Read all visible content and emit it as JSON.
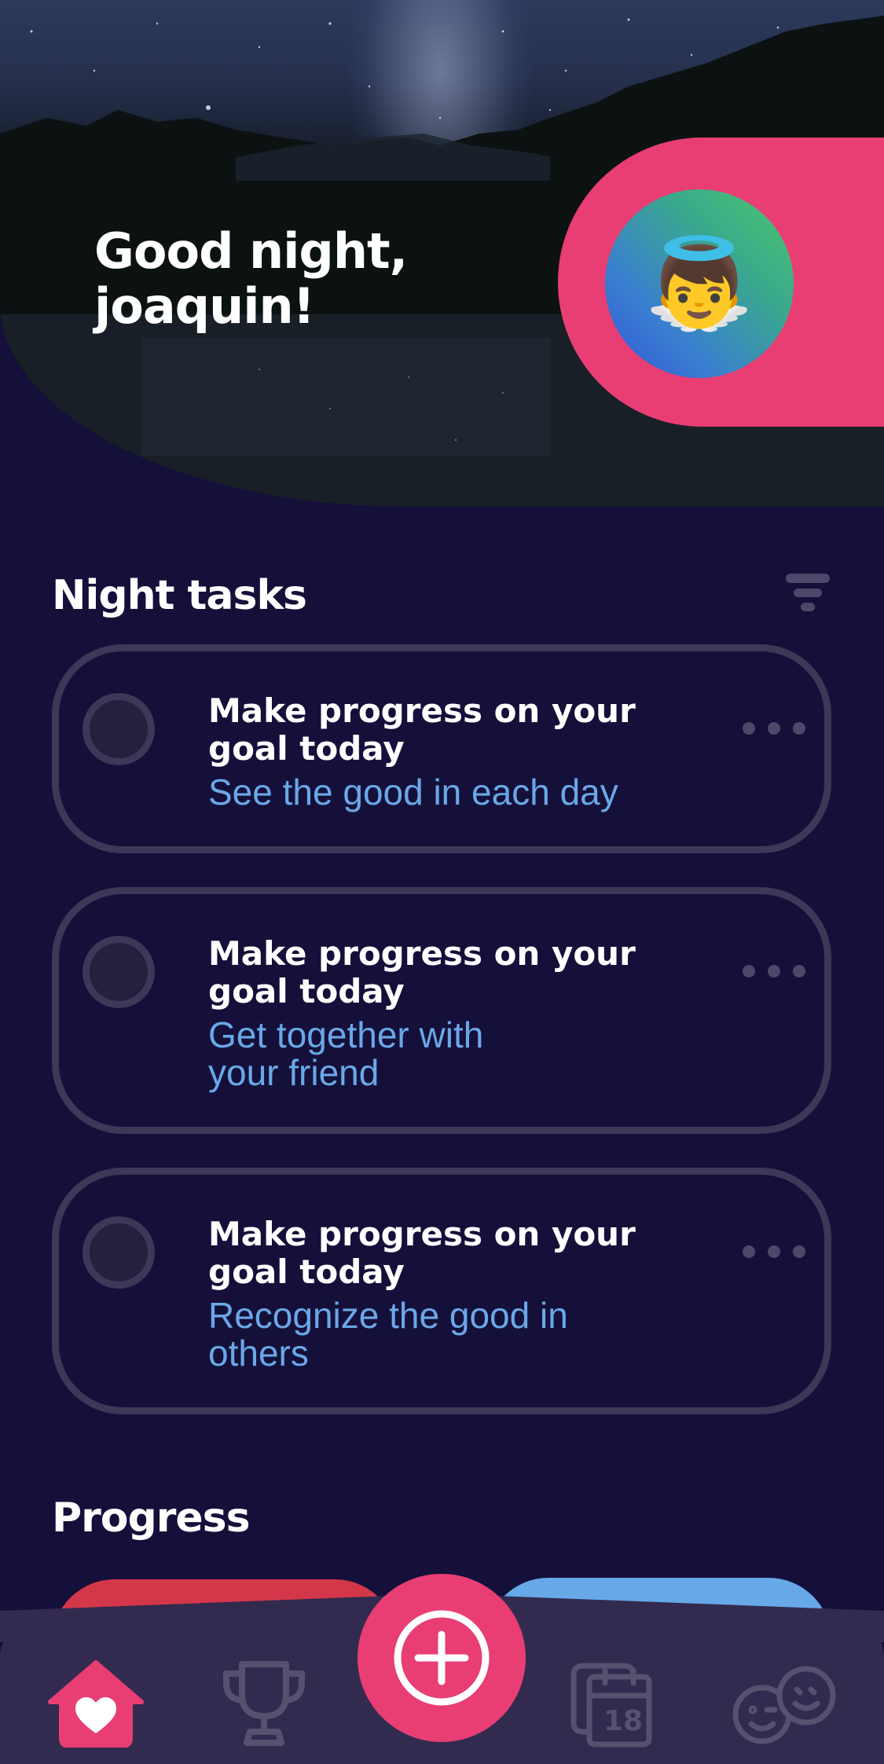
{
  "header": {
    "greeting": "Good night, joaquin!",
    "avatar_emoji": "👼"
  },
  "tasks_section": {
    "title": "Night tasks",
    "filter_icon": "filter-icon",
    "items": [
      {
        "title": "Make progress on your goal today",
        "subtitle": "See the good in each day"
      },
      {
        "title": "Make progress on your goal today",
        "subtitle": "Get together with your friend"
      },
      {
        "title": "Make progress on your goal today",
        "subtitle": "Recognize the good in others"
      }
    ]
  },
  "progress_section": {
    "title": "Progress"
  },
  "tabbar": {
    "calendar_day": "18",
    "items": [
      "home-icon",
      "trophy-icon",
      "add-icon",
      "calendar-icon",
      "friends-icon"
    ]
  },
  "colors": {
    "background": "#15103a",
    "accent_pink": "#e83e74",
    "card_border": "#3d3758",
    "subtitle_blue": "#6aa8e8",
    "tabbar": "#322b4f"
  }
}
